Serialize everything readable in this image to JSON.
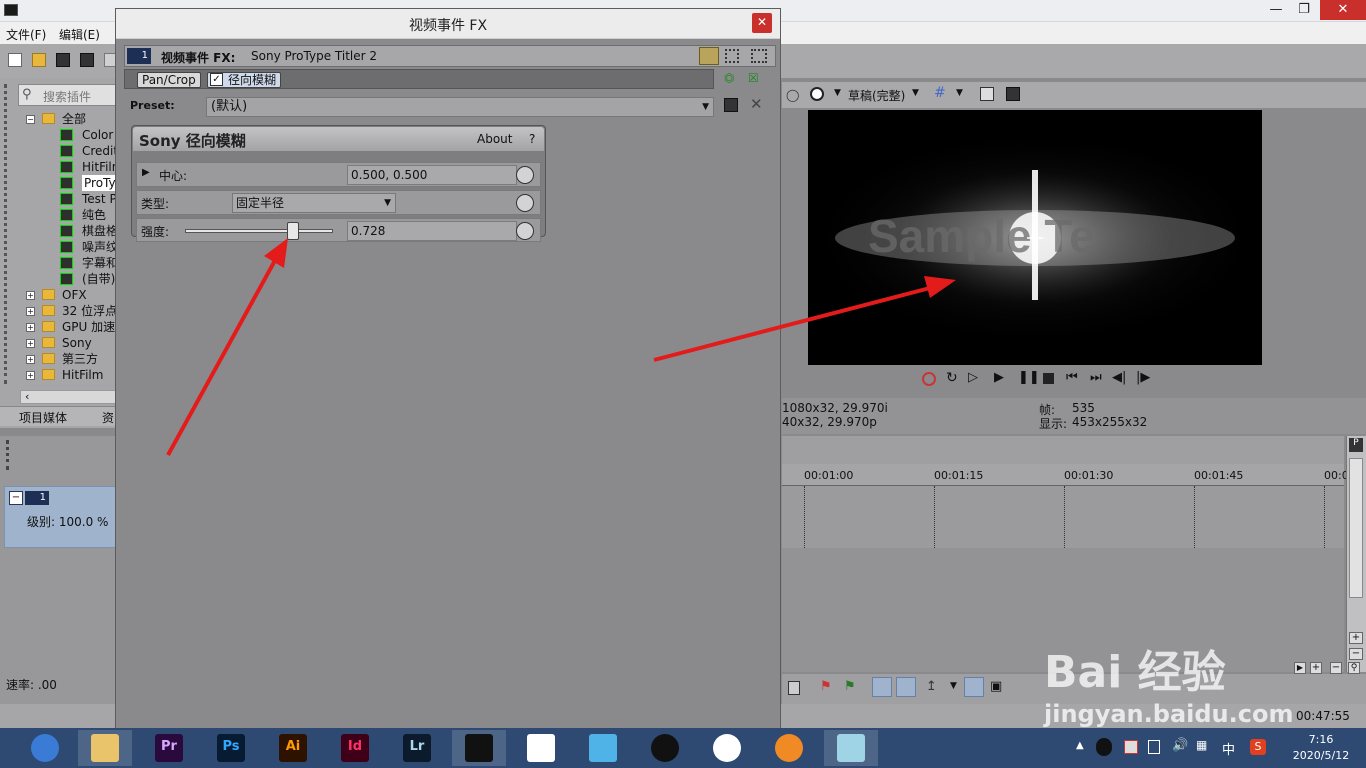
{
  "app": {
    "menu": [
      "文件(F)",
      "编辑(E)"
    ],
    "left_panel": {
      "search_placeholder": "搜索插件",
      "tree": [
        {
          "label": "全部",
          "level": 0,
          "type": "folder",
          "expanded": true
        },
        {
          "label": "Color",
          "level": 1,
          "type": "plugin"
        },
        {
          "label": "Credit",
          "level": 1,
          "type": "plugin"
        },
        {
          "label": "HitFilm",
          "level": 1,
          "type": "plugin"
        },
        {
          "label": "ProTy",
          "level": 1,
          "type": "plugin",
          "selected": true
        },
        {
          "label": "Test P",
          "level": 1,
          "type": "plugin"
        },
        {
          "label": "纯色",
          "level": 1,
          "type": "plugin"
        },
        {
          "label": "棋盘格",
          "level": 1,
          "type": "plugin"
        },
        {
          "label": "噪声纹",
          "level": 1,
          "type": "plugin"
        },
        {
          "label": "字幕和",
          "level": 1,
          "type": "plugin"
        },
        {
          "label": "(自带)",
          "level": 1,
          "type": "plugin"
        },
        {
          "label": "OFX",
          "level": 0,
          "type": "folder"
        },
        {
          "label": "32 位浮点",
          "level": 0,
          "type": "folder"
        },
        {
          "label": "GPU 加速",
          "level": 0,
          "type": "folder"
        },
        {
          "label": "Sony",
          "level": 0,
          "type": "folder"
        },
        {
          "label": "第三方",
          "level": 0,
          "type": "folder"
        },
        {
          "label": "HitFilm",
          "level": 0,
          "type": "folder"
        }
      ],
      "tabs": [
        "项目媒体",
        "资"
      ]
    },
    "track": {
      "number": "1",
      "level_label": "级别: 100.0 %"
    },
    "speed_label": "速率: .00",
    "preview": {
      "quality": "草稿(完整)",
      "overlay_text": "Sample Te",
      "info_left_1": "1080x32, 29.970i",
      "info_left_2": "40x32, 29.970p",
      "frame_label": "帧:",
      "frame_value": "535",
      "display_label": "显示:",
      "display_value": "453x255x32"
    },
    "timeline": {
      "ticks": [
        "00:01:00",
        "00:01:15",
        "00:01:30",
        "00:01:45",
        "00:0"
      ]
    },
    "status_time": "00:47:55"
  },
  "fx_dialog": {
    "title": "视频事件 FX",
    "header_label": "视频事件 FX:",
    "header_value": "Sony ProType Titler 2",
    "track_badge": "1",
    "chain": [
      "Pan/Crop",
      "径向模糊"
    ],
    "preset_label": "Preset:",
    "preset_value": "(默认)",
    "plugin_title": "Sony 径向模糊",
    "about_label": "About",
    "help_label": "?",
    "params": [
      {
        "label": "中心:",
        "value": "0.500, 0.500"
      },
      {
        "label": "类型:",
        "value": "固定半径"
      },
      {
        "label": "强度:",
        "value": "0.728",
        "slider": 0.728
      }
    ]
  },
  "taskbar": {
    "apps": [
      {
        "name": "browser",
        "text": "",
        "bg": "#3a7bd5",
        "fg": "#ffffff"
      },
      {
        "name": "explorer",
        "text": "",
        "bg": "#e9c46a",
        "fg": "#333333"
      },
      {
        "name": "premiere",
        "text": "Pr",
        "bg": "#2a0a3d",
        "fg": "#d9a6ff"
      },
      {
        "name": "photoshop",
        "text": "Ps",
        "bg": "#071c33",
        "fg": "#31a8ff"
      },
      {
        "name": "illustrator",
        "text": "Ai",
        "bg": "#2e1200",
        "fg": "#ff9a00"
      },
      {
        "name": "indesign",
        "text": "Id",
        "bg": "#3d0018",
        "fg": "#ff3366"
      },
      {
        "name": "lightroom",
        "text": "Lr",
        "bg": "#0b1b2b",
        "fg": "#add5ec"
      },
      {
        "name": "vegas",
        "text": "",
        "bg": "#111111",
        "fg": "#ffffff"
      },
      {
        "name": "app-umbrella",
        "text": "",
        "bg": "#ffffff",
        "fg": "#e63946"
      },
      {
        "name": "app-bird",
        "text": "",
        "bg": "#4fb3e8",
        "fg": "#ffffff"
      },
      {
        "name": "qq",
        "text": "",
        "bg": "#111111",
        "fg": "#f4c430"
      },
      {
        "name": "chrome",
        "text": "",
        "bg": "#ffffff",
        "fg": "#4285f4"
      },
      {
        "name": "app-orange",
        "text": "",
        "bg": "#f08a24",
        "fg": "#ffffff"
      },
      {
        "name": "app-notepad",
        "text": "",
        "bg": "#9fd3e6",
        "fg": "#ffffff"
      }
    ],
    "tray_ime": "中",
    "time": "7:16",
    "date": "2020/5/12"
  },
  "watermark": {
    "brand": "Bai 经验",
    "url": "jingyan.baidu.com"
  },
  "colors": {
    "arrow": "#e41b1b",
    "accent_blue": "#9fb3cc"
  }
}
